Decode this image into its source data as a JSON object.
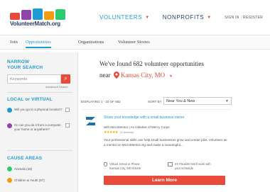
{
  "header": {
    "logo_text": "VolunteerMatch.org",
    "nav": [
      {
        "label": "VOLUNTEERS",
        "caret": "▼"
      },
      {
        "label": "NONPROFITS",
        "caret": "▼"
      }
    ],
    "signin": "SIGN IN  ·  REGISTER",
    "colors": {
      "accent": "#1f9bd4",
      "brand_dark": "#2a3f6c",
      "cta": "#e84b3a"
    }
  },
  "subnav": {
    "items": [
      "Join",
      "Opportunities",
      "Organizations",
      "Volunteer Stories"
    ],
    "active": "Opportunities"
  },
  "sidebar": {
    "narrow_title": "NARROW\nYOUR SEARCH",
    "keyword_placeholder": "Keywords",
    "advanced": "Advanced Search",
    "local_title": "LOCAL or VIRTUAL",
    "local_options": [
      {
        "label": "Will you go to a physical location?"
      },
      {
        "label": "Or can you do it from a computer, your home or anywhere?"
      }
    ],
    "cause_title": "CAUSE AREAS",
    "causes": [
      {
        "label": "Animals (48)",
        "color": "#2ecc71"
      },
      {
        "label": "Children & Youth (57)",
        "color": "#f39c12"
      }
    ]
  },
  "main": {
    "headline": "We've found 682 volunteer opportunities",
    "near_label": "near",
    "city": "Kansas City, MO",
    "results_label": "DISPLAYING 1 - 10 OF 682",
    "sort_label": "SORT BY",
    "sort_value": "Near You & New",
    "card": {
      "title": "Share your knowledge with a small business owner",
      "org": "with MicroMentor | An initiative of Mercy Corps",
      "stars": "★★★★★",
      "reviews": "(3 reviews)",
      "description": "Your professional skills can help small businesses grow and create jobs. Volunteer as a mentor on MicroMentor.org and make a meaningful...",
      "location": "Virtual: Email or Phone\nKansas City, MO 64105",
      "time": "It's Flexible! We'll work with\nyour schedule",
      "cta": "Learn More"
    }
  }
}
